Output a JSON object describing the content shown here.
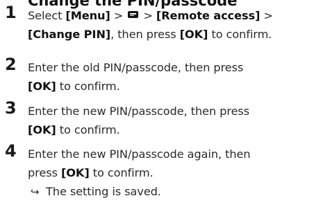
{
  "heading_fragment": "Change the PIN/passcode",
  "steps": [
    {
      "number": "1",
      "pre1": "Select ",
      "menu": "[Menu]",
      "sep1": " > ",
      "icon": "phone-menu-icon",
      "sep2": " > ",
      "remote": "[Remote access]",
      "sep3": " >",
      "change": "[Change PIN]",
      "mid": ", then press ",
      "ok": "[OK]",
      "end": " to confirm."
    },
    {
      "number": "2",
      "line1": "Enter the old PIN/passcode, then press",
      "ok": "[OK]",
      "end": " to confirm."
    },
    {
      "number": "3",
      "line1": "Enter the new PIN/passcode, then press",
      "ok": "[OK]",
      "end": " to confirm."
    },
    {
      "number": "4",
      "line1": "Enter the new PIN/passcode again, then",
      "pre2": "press ",
      "ok": "[OK]",
      "end": " to confirm.",
      "arrow": "↪",
      "result": "The setting is saved."
    }
  ]
}
